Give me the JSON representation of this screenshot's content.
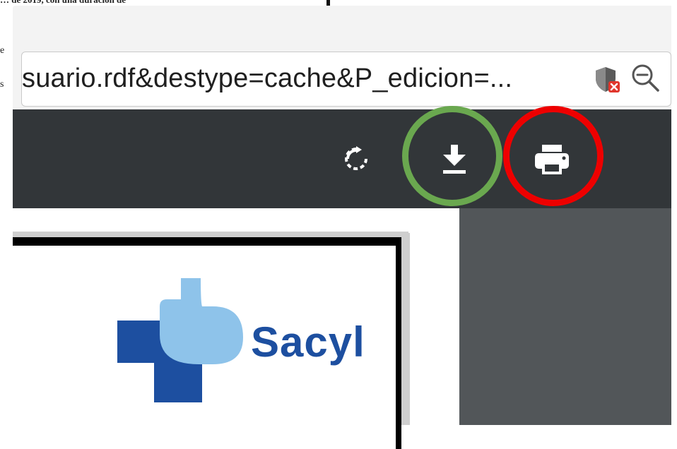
{
  "background_document": {
    "top_text": "… de 2019, con una duración de",
    "fragment_e": "e",
    "fragment_s": "s"
  },
  "browser": {
    "url": "suario.rdf&destype=cache&P_edicion=...",
    "icons": [
      "shield-blocked-icon",
      "zoom-out-icon"
    ]
  },
  "pdf_toolbar": {
    "buttons": [
      "rotate-icon",
      "download-icon",
      "print-icon"
    ],
    "highlight_colors": {
      "download": "#6aa84f",
      "print": "#ee0000"
    },
    "toolbar_color": "#323639"
  },
  "document": {
    "logo_text": "Sacyl",
    "logo_colors": {
      "cross": "#1d4fa0",
      "light_shape": "#8ec3ea"
    }
  }
}
